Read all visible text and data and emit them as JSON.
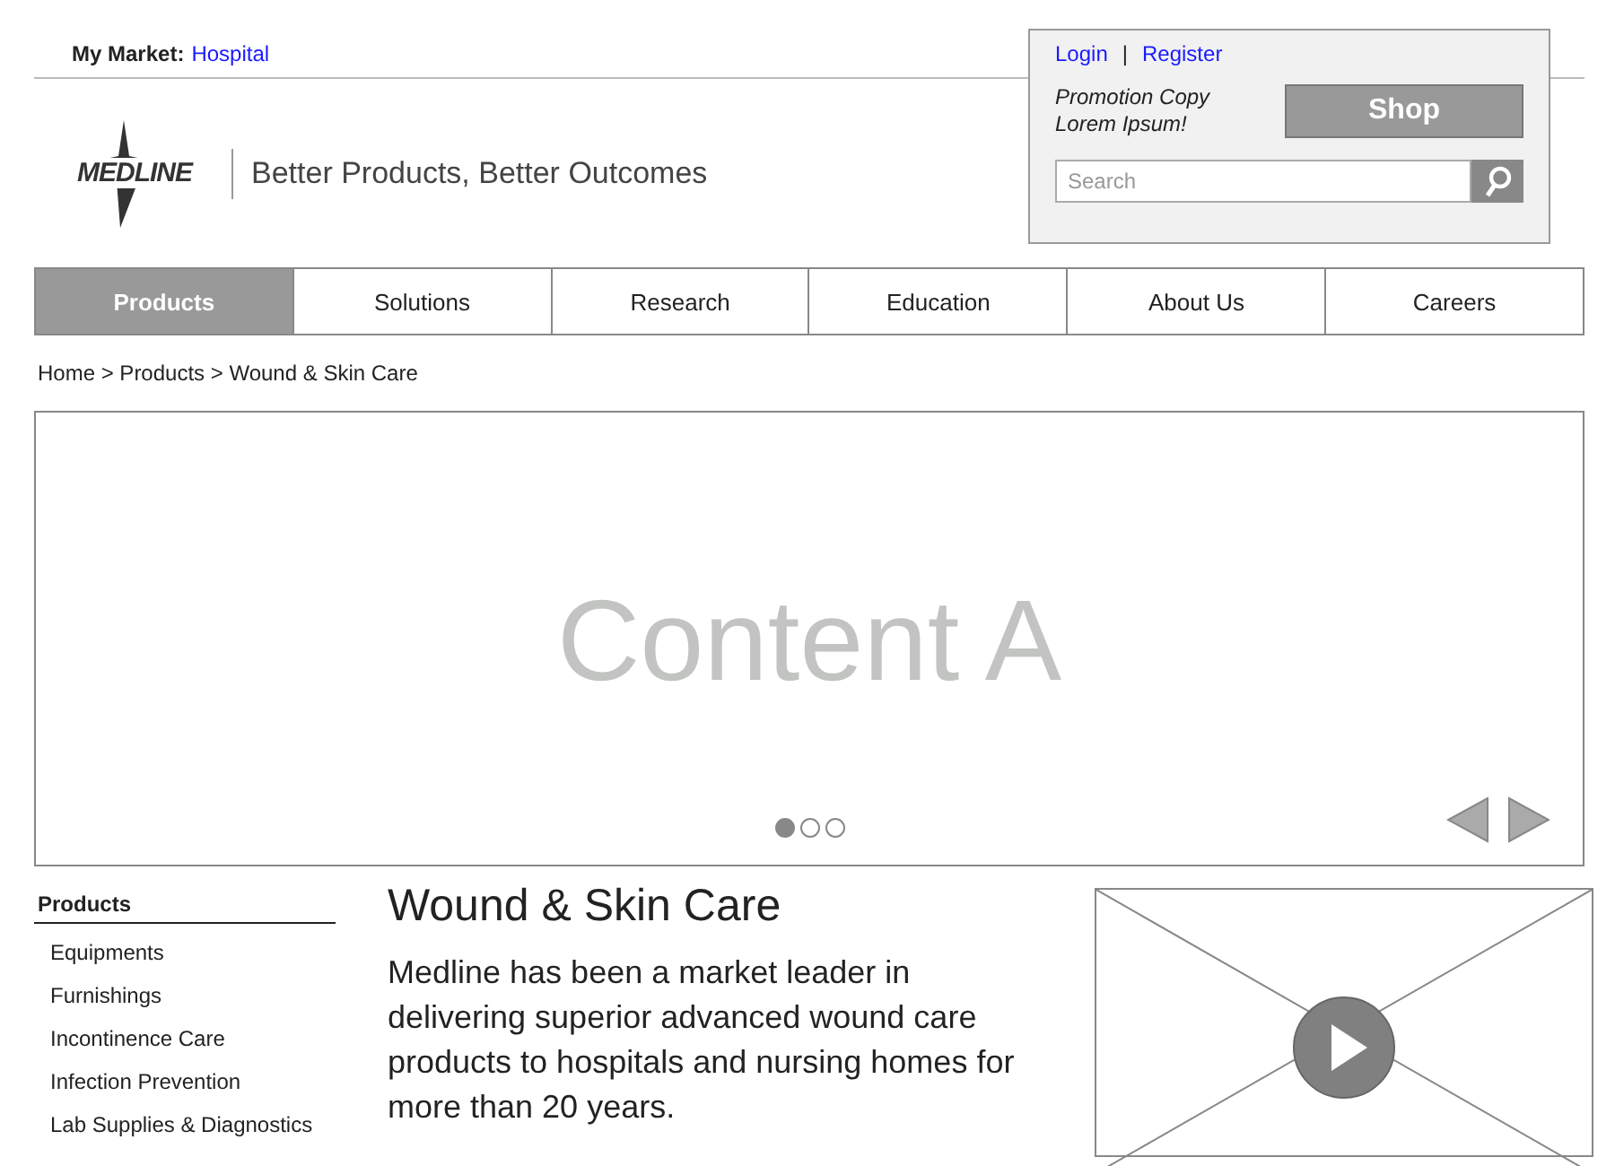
{
  "market": {
    "label": "My Market:",
    "value": "Hospital"
  },
  "logo": {
    "text": "MEDLINE",
    "tagline": "Better Products, Better Outcomes"
  },
  "account": {
    "login": "Login",
    "separator": "|",
    "register": "Register"
  },
  "promo": {
    "copy": "Promotion Copy\nLorem Ipsum!",
    "button": "Shop"
  },
  "search": {
    "placeholder": "Search"
  },
  "nav": [
    {
      "label": "Products",
      "selected": true
    },
    {
      "label": "Solutions",
      "selected": false
    },
    {
      "label": "Research",
      "selected": false
    },
    {
      "label": "Education",
      "selected": false
    },
    {
      "label": "About Us",
      "selected": false
    },
    {
      "label": "Careers",
      "selected": false
    }
  ],
  "breadcrumb": "Home > Products > Wound & Skin Care",
  "carousel": {
    "title": "Content A",
    "dots": [
      {
        "selected": true
      },
      {
        "selected": false
      },
      {
        "selected": false
      }
    ]
  },
  "sidebar": {
    "title": "Products",
    "items": [
      "Equipments",
      "Furnishings",
      "Incontinence Care",
      "Infection Prevention",
      "Lab Supplies & Diagnostics"
    ]
  },
  "article": {
    "title": "Wound & Skin Care",
    "body": "Medline has been a market leader in delivering superior advanced wound care products to hospitals and nursing homes for more than 20 years."
  }
}
